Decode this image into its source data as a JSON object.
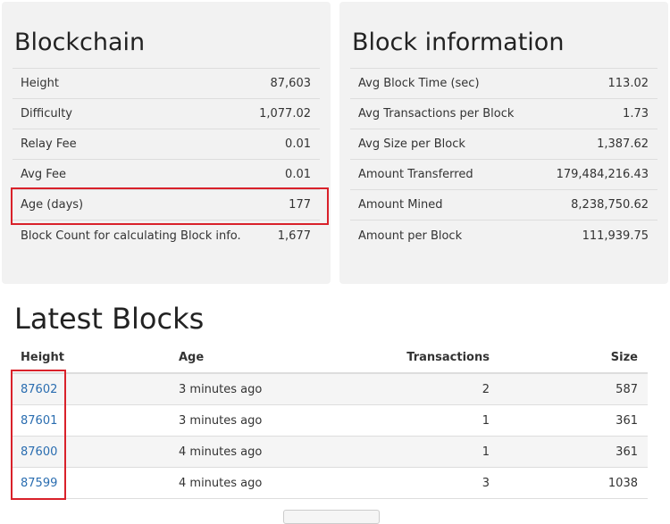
{
  "blockchain": {
    "title": "Blockchain",
    "rows": [
      {
        "label": "Height",
        "value": "87,603"
      },
      {
        "label": "Difficulty",
        "value": "1,077.02"
      },
      {
        "label": "Relay Fee",
        "value": "0.01"
      },
      {
        "label": "Avg Fee",
        "value": "0.01"
      },
      {
        "label": "Age (days)",
        "value": "177"
      },
      {
        "label": "Block Count for calculating Block info.",
        "value": "1,677"
      }
    ]
  },
  "block_information": {
    "title": "Block information",
    "rows": [
      {
        "label": "Avg Block Time (sec)",
        "value": "113.02"
      },
      {
        "label": "Avg Transactions per Block",
        "value": "1.73"
      },
      {
        "label": "Avg Size per Block",
        "value": "1,387.62"
      },
      {
        "label": "Amount Transferred",
        "value": "179,484,216.43"
      },
      {
        "label": "Amount Mined",
        "value": "8,238,750.62"
      },
      {
        "label": "Amount per Block",
        "value": "111,939.75"
      }
    ]
  },
  "latest_blocks": {
    "title": "Latest Blocks",
    "columns": [
      "Height",
      "Age",
      "Transactions",
      "Size"
    ],
    "rows": [
      {
        "height": "87602",
        "age": "3 minutes ago",
        "transactions": "2",
        "size": "587"
      },
      {
        "height": "87601",
        "age": "3 minutes ago",
        "transactions": "1",
        "size": "361"
      },
      {
        "height": "87600",
        "age": "4 minutes ago",
        "transactions": "1",
        "size": "361"
      },
      {
        "height": "87599",
        "age": "4 minutes ago",
        "transactions": "3",
        "size": "1038"
      }
    ]
  },
  "colors": {
    "link": "#2a6db0",
    "highlight": "#d9212a",
    "panel": "#f2f2f2"
  }
}
